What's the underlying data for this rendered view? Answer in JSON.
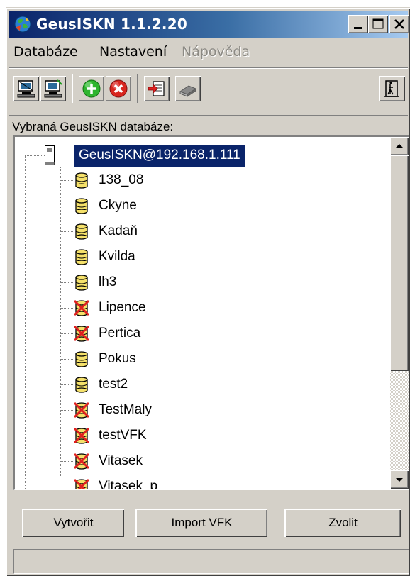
{
  "window": {
    "title": "GeusISKN 1.1.2.20",
    "controls": {
      "minimize_icon": "minimize-icon",
      "maximize_icon": "maximize-icon",
      "close_icon": "close-icon"
    }
  },
  "menu": [
    {
      "label": "Databáze",
      "enabled": true
    },
    {
      "label": "Nastavení",
      "enabled": true
    },
    {
      "label": "Nápověda",
      "enabled": false
    }
  ],
  "toolbar": {
    "icons": [
      "disconnect-icon",
      "connect-icon",
      "add-icon",
      "delete-icon",
      "import-icon",
      "book-icon",
      "exit-door-icon"
    ]
  },
  "db_label": "Vybraná GeusISKN databáze:",
  "tree": {
    "root": "GeusISKN@192.168.1.111",
    "items": [
      {
        "label": "138_08",
        "status": "ok"
      },
      {
        "label": "Ckyne",
        "status": "ok"
      },
      {
        "label": "Kadaň",
        "status": "ok"
      },
      {
        "label": "Kvilda",
        "status": "ok"
      },
      {
        "label": "lh3",
        "status": "ok"
      },
      {
        "label": "Lipence",
        "status": "error"
      },
      {
        "label": "Pertica",
        "status": "error"
      },
      {
        "label": "Pokus",
        "status": "ok"
      },
      {
        "label": "test2",
        "status": "ok"
      },
      {
        "label": "TestMaly",
        "status": "error"
      },
      {
        "label": "testVFK",
        "status": "error"
      },
      {
        "label": "Vitasek",
        "status": "error"
      },
      {
        "label": "Vitasek_p",
        "status": "error"
      }
    ]
  },
  "buttons": {
    "create": "Vytvořit",
    "import": "Import VFK",
    "choose": "Zvolit"
  },
  "colors": {
    "face": "#d4d0c8",
    "title_start": "#0a246a",
    "title_end": "#a6caf0",
    "selection": "#0a246a",
    "db_ok": "#f5e16a",
    "db_error": "#e02020"
  }
}
